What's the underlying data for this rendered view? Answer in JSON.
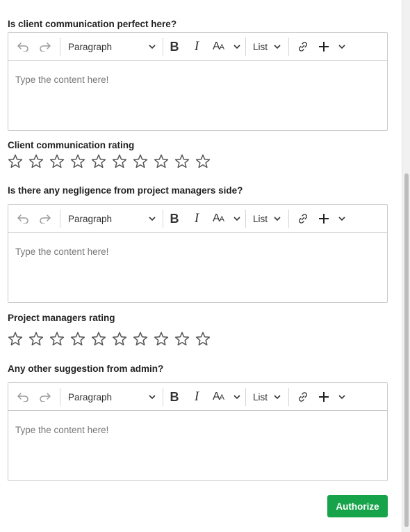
{
  "sections": [
    {
      "question": "Is client communication perfect here?",
      "editor": {
        "block_format": "Paragraph",
        "list_label": "List",
        "placeholder": "Type the content here!"
      }
    },
    {
      "rating_label": "Client communication rating",
      "stars": 10,
      "filled": 0
    },
    {
      "question": "Is there any negligence from project managers side?",
      "editor": {
        "block_format": "Paragraph",
        "list_label": "List",
        "placeholder": "Type the content here!"
      }
    },
    {
      "rating_label": "Project managers rating",
      "stars": 10,
      "filled": 0
    },
    {
      "question": "Any other suggestion from admin?",
      "editor": {
        "block_format": "Paragraph",
        "list_label": "List",
        "placeholder": "Type the content here!"
      }
    }
  ],
  "toolbar_icons": {
    "bold": "B",
    "italic": "I",
    "font_size": "AA"
  },
  "submit": {
    "label": "Authorize",
    "color": "#16a34a"
  },
  "colors": {
    "border": "#c9c9c9",
    "star_outline": "#555555",
    "placeholder": "#777777"
  }
}
